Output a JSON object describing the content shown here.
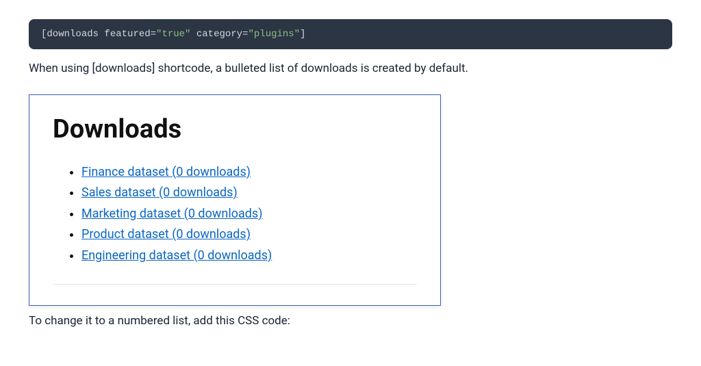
{
  "code_example": {
    "open_bracket": "[",
    "tag": "downloads",
    "attr1_key": " featured=",
    "attr1_val": "\"true\"",
    "attr2_key": " category=",
    "attr2_val": "\"plugins\"",
    "close_bracket": "]"
  },
  "intro_text": "When using [downloads] shortcode, a bulleted list of downloads is created by default.",
  "example": {
    "heading": "Downloads",
    "items": [
      "Finance dataset (0 downloads)",
      "Sales dataset (0 downloads)",
      "Marketing dataset (0 downloads)",
      "Product dataset (0 downloads)",
      "Engineering dataset (0 downloads)"
    ]
  },
  "outro_text": "To change it to a numbered list, add this CSS code:"
}
